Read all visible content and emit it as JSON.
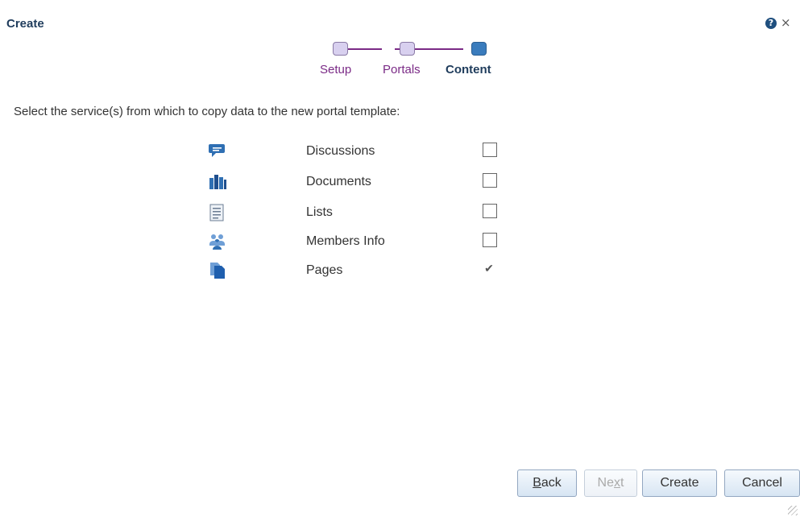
{
  "dialog": {
    "title": "Create",
    "help_icon": "?",
    "close_icon": "×"
  },
  "train": {
    "steps": [
      {
        "label": "Setup",
        "state": "visited"
      },
      {
        "label": "Portals",
        "state": "visited"
      },
      {
        "label": "Content",
        "state": "current"
      }
    ]
  },
  "instruction": "Select the service(s) from which to copy data to the new portal template:",
  "services": [
    {
      "label": "Discussions",
      "icon": "discussions-icon",
      "checked": false
    },
    {
      "label": "Documents",
      "icon": "documents-icon",
      "checked": false
    },
    {
      "label": "Lists",
      "icon": "lists-icon",
      "checked": false
    },
    {
      "label": "Members Info",
      "icon": "members-icon",
      "checked": false
    },
    {
      "label": "Pages",
      "icon": "pages-icon",
      "checked": true
    }
  ],
  "checkmark": "✔",
  "buttons": {
    "back": {
      "pre": "",
      "key": "B",
      "post": "ack"
    },
    "next": {
      "pre": "Ne",
      "key": "x",
      "post": "t",
      "disabled": true
    },
    "create": "Create",
    "cancel": "Cancel"
  },
  "colors": {
    "accent": "#1f3c5c",
    "train": "#7a2a86",
    "icon_blue": "#2f6fb3"
  }
}
